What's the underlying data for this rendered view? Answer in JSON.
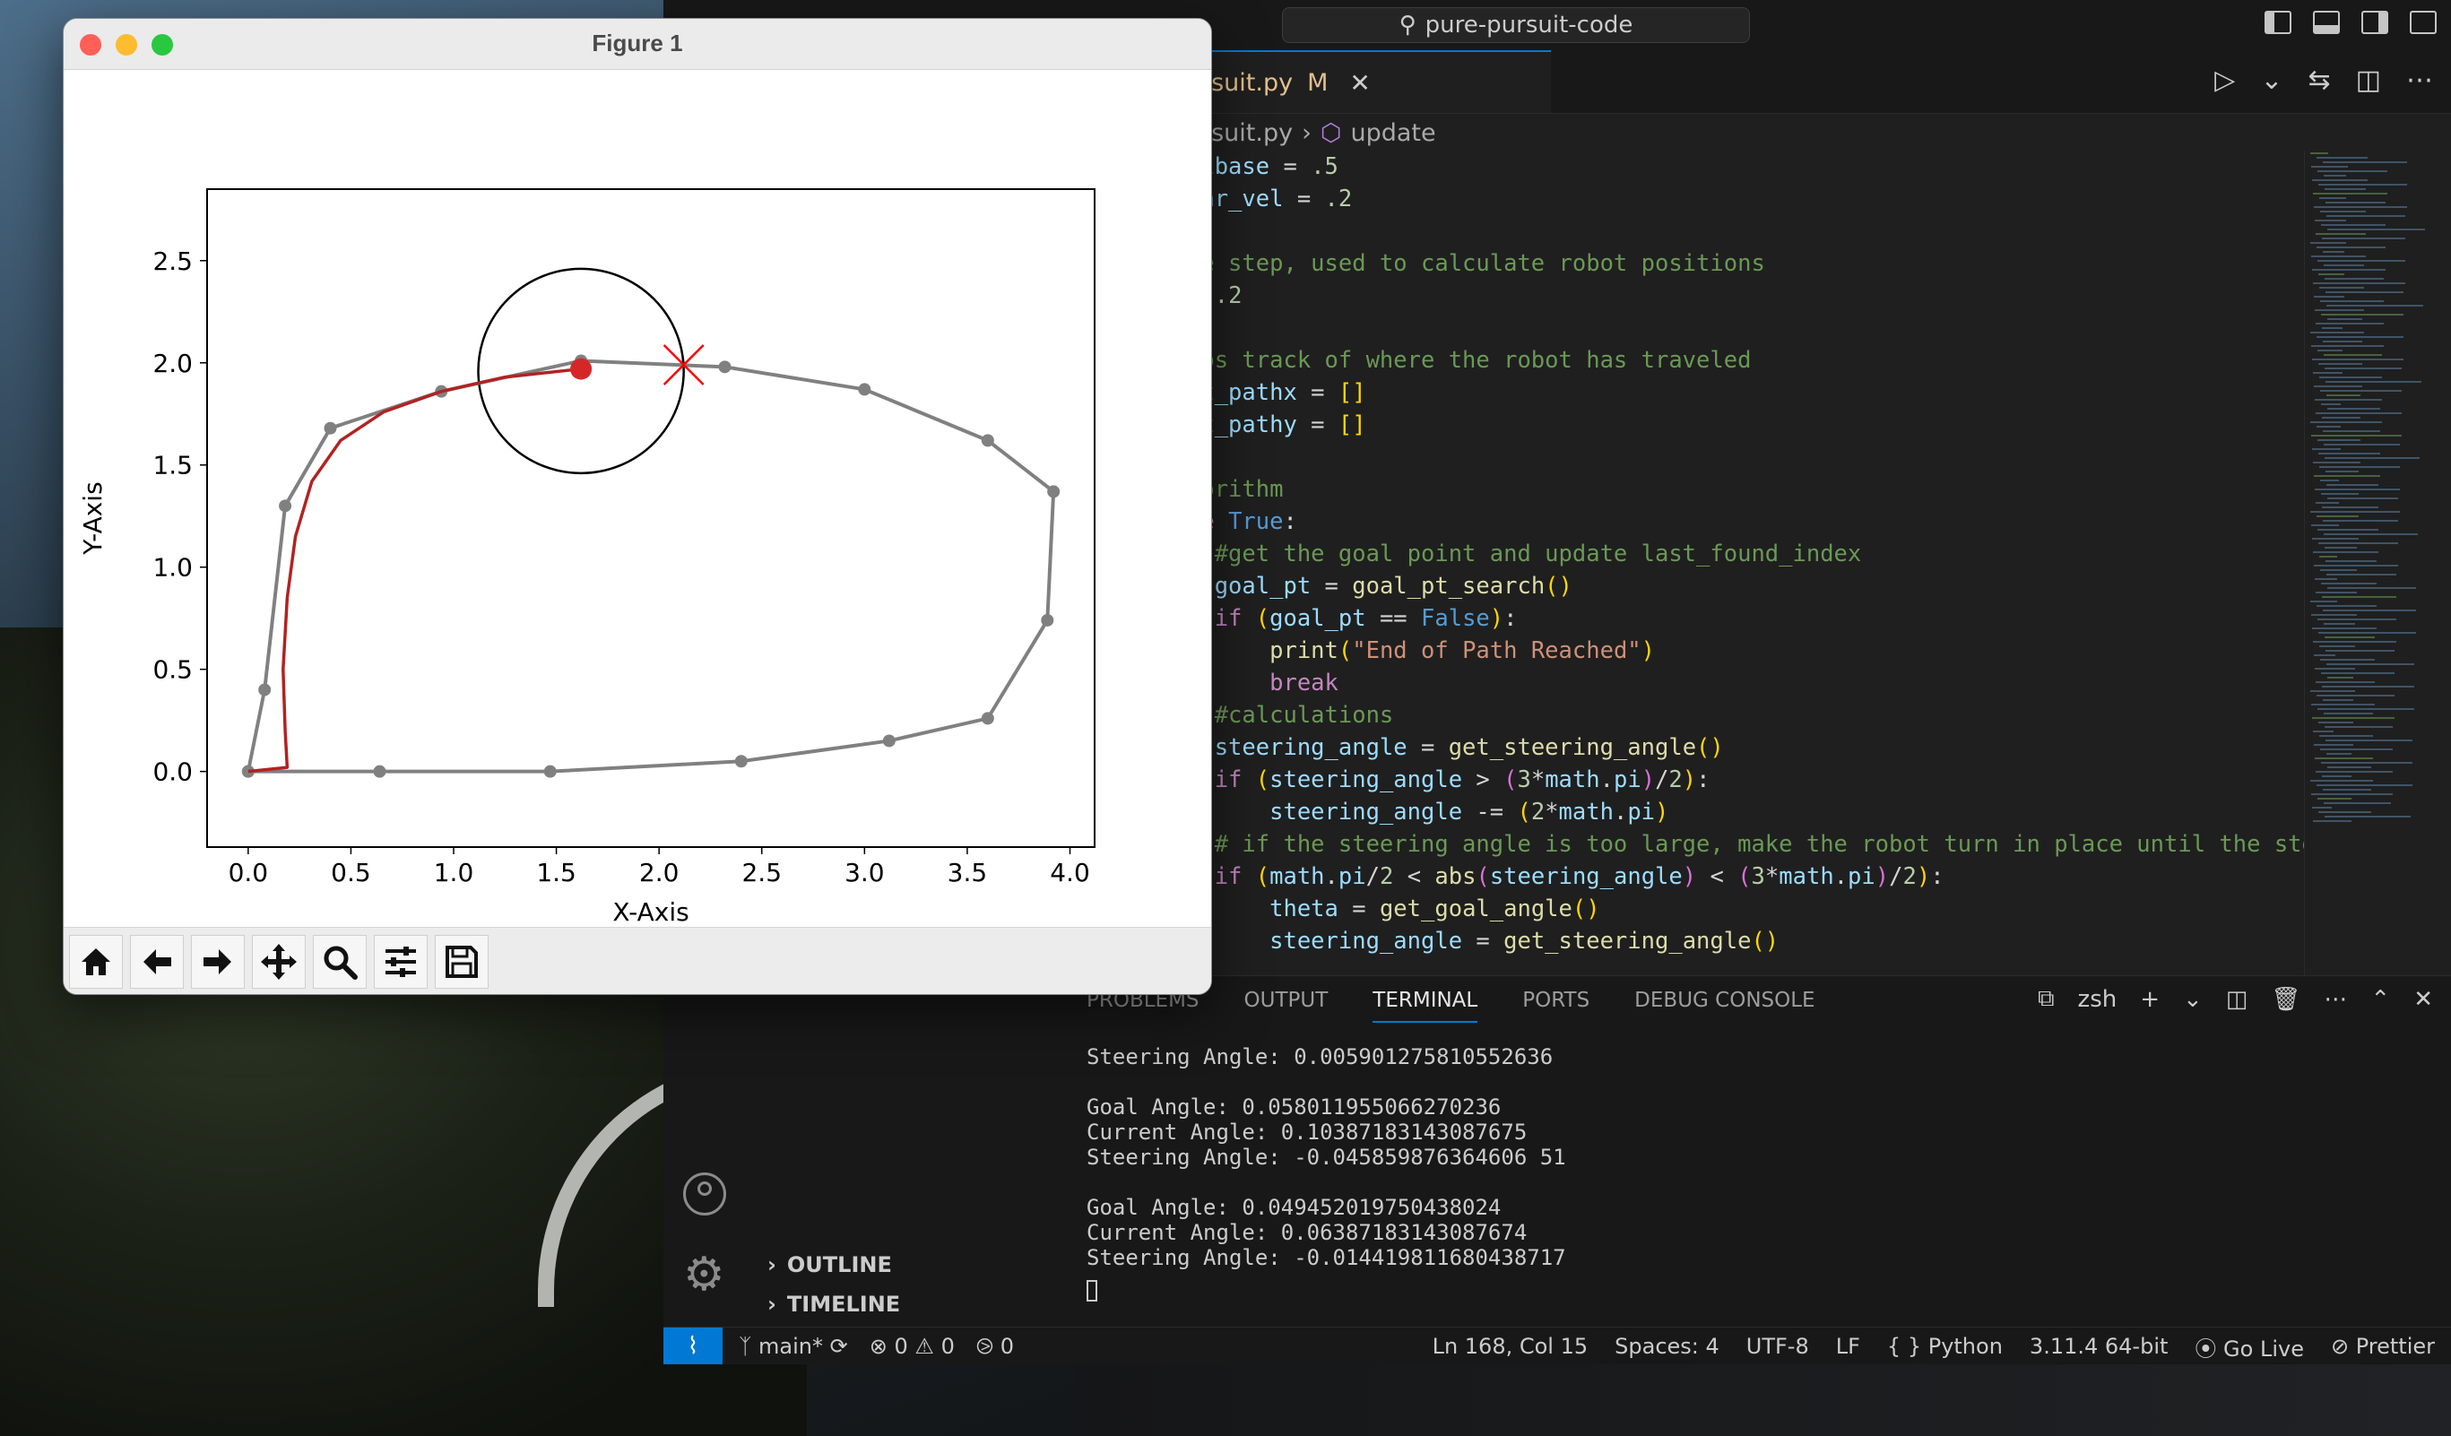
{
  "figure": {
    "title": "Figure 1",
    "toolbar": [
      "home-icon",
      "back-arrow-icon",
      "forward-arrow-icon",
      "pan-move-icon",
      "zoom-magnifier-icon",
      "configure-subplots-icon",
      "save-disk-icon"
    ]
  },
  "chart_data": {
    "type": "scatter",
    "xlabel": "X-Axis",
    "ylabel": "Y-Axis",
    "xlim": [
      -0.2,
      4.12
    ],
    "ylim": [
      -0.37,
      2.85
    ],
    "xticks": [
      "0.0",
      "0.5",
      "1.0",
      "1.5",
      "2.0",
      "2.5",
      "3.0",
      "3.5",
      "4.0"
    ],
    "yticks": [
      "0.0",
      "0.5",
      "1.0",
      "1.5",
      "2.0",
      "2.5"
    ],
    "grid": false,
    "series": [
      {
        "role": "path",
        "color": "#808080",
        "x": [
          0.0,
          0.64,
          1.47,
          2.4,
          3.12,
          3.6,
          3.89,
          3.92,
          3.6,
          3.0,
          2.32,
          1.62,
          0.94,
          0.4,
          0.18,
          0.08,
          0.0
        ],
        "y": [
          0.0,
          0.0,
          0.0,
          0.05,
          0.15,
          0.26,
          0.74,
          1.37,
          1.62,
          1.87,
          1.98,
          2.01,
          1.86,
          1.68,
          1.3,
          0.4,
          0.0
        ]
      },
      {
        "role": "robot-trajectory",
        "color": "#b22222",
        "x": [
          0.0,
          0.19,
          0.18,
          0.17,
          0.19,
          0.23,
          0.31,
          0.45,
          0.66,
          0.94,
          1.25,
          1.62
        ],
        "y": [
          0.0,
          0.02,
          0.2,
          0.5,
          0.85,
          1.15,
          1.42,
          1.62,
          1.76,
          1.86,
          1.93,
          1.97
        ]
      }
    ],
    "robot_position": {
      "x": 1.62,
      "y": 1.97,
      "color": "#d62728"
    },
    "lookahead_circle": {
      "cx": 1.62,
      "cy": 1.96,
      "r": 0.5,
      "color": "#000000"
    },
    "goal_point": {
      "x": 2.12,
      "y": 1.99,
      "color": "#ff0000",
      "marker": "x"
    }
  },
  "vscode": {
    "search": "pure-pursuit-code",
    "tab": {
      "name": "rsuit.py",
      "modified": "M",
      "close": "✕"
    },
    "breadcrumb": {
      "file": "rsuit.py",
      "symbol": "update"
    },
    "code": [
      [
        [
          "tk-var",
          "elbase"
        ],
        [
          "tk-op",
          " = "
        ],
        [
          "tk-num",
          ".5"
        ]
      ],
      [
        [
          "tk-var",
          "ear_vel"
        ],
        [
          "tk-op",
          " = "
        ],
        [
          "tk-num",
          ".2"
        ]
      ],
      [],
      [
        [
          "tk-com",
          "ne step, used to calculate robot positions"
        ]
      ],
      [
        [
          "tk-op",
          "= "
        ],
        [
          "tk-num",
          ".2"
        ]
      ],
      [],
      [
        [
          "tk-com",
          "eps track of where the robot has traveled"
        ]
      ],
      [
        [
          "tk-var",
          "ot_pathx"
        ],
        [
          "tk-op",
          " = "
        ],
        [
          "tk-br",
          "[]"
        ]
      ],
      [
        [
          "tk-var",
          "ot_pathy"
        ],
        [
          "tk-op",
          " = "
        ],
        [
          "tk-br",
          "[]"
        ]
      ],
      [],
      [
        [
          "tk-com",
          "gorithm"
        ]
      ],
      [
        [
          "tk-ctl",
          "le "
        ],
        [
          "tk-kw",
          "True"
        ],
        [
          "tk-op",
          ":"
        ]
      ],
      [
        [
          "tk-com",
          "  #get the goal point and update last_found_index"
        ]
      ],
      [
        [
          "tk-var",
          "  goal_pt"
        ],
        [
          "tk-op",
          " = "
        ],
        [
          "tk-fn",
          "goal_pt_search"
        ],
        [
          "tk-br",
          "()"
        ]
      ],
      [
        [
          "tk-ctl",
          "  if "
        ],
        [
          "tk-br",
          "("
        ],
        [
          "tk-var",
          "goal_pt"
        ],
        [
          "tk-op",
          " == "
        ],
        [
          "tk-kw",
          "False"
        ],
        [
          "tk-br",
          ")"
        ],
        [
          "tk-op",
          ":"
        ]
      ],
      [
        [
          "tk-fn",
          "      print"
        ],
        [
          "tk-br",
          "("
        ],
        [
          "tk-str",
          "\"End of Path Reached\""
        ],
        [
          "tk-br",
          ")"
        ]
      ],
      [
        [
          "tk-ctl",
          "      break"
        ]
      ],
      [
        [
          "tk-com",
          "  #calculations"
        ]
      ],
      [
        [
          "tk-var",
          "  steering_angle"
        ],
        [
          "tk-op",
          " = "
        ],
        [
          "tk-fn",
          "get_steering_angle"
        ],
        [
          "tk-br",
          "()"
        ]
      ],
      [
        [
          "tk-ctl",
          "  if "
        ],
        [
          "tk-br",
          "("
        ],
        [
          "tk-var",
          "steering_angle"
        ],
        [
          "tk-op",
          " > "
        ],
        [
          "tk-br2",
          "("
        ],
        [
          "tk-num",
          "3"
        ],
        [
          "tk-op",
          "*"
        ],
        [
          "tk-var",
          "math"
        ],
        [
          "tk-op",
          "."
        ],
        [
          "tk-var",
          "pi"
        ],
        [
          "tk-br2",
          ")"
        ],
        [
          "tk-op",
          "/"
        ],
        [
          "tk-num",
          "2"
        ],
        [
          "tk-br",
          ")"
        ],
        [
          "tk-op",
          ":"
        ]
      ],
      [
        [
          "tk-var",
          "      steering_angle"
        ],
        [
          "tk-op",
          " -= "
        ],
        [
          "tk-br",
          "("
        ],
        [
          "tk-num",
          "2"
        ],
        [
          "tk-op",
          "*"
        ],
        [
          "tk-var",
          "math"
        ],
        [
          "tk-op",
          "."
        ],
        [
          "tk-var",
          "pi"
        ],
        [
          "tk-br",
          ")"
        ]
      ],
      [
        [
          "tk-com",
          "  # if the steering angle is too large, make the robot turn in place until the steerin"
        ]
      ],
      [
        [
          "tk-ctl",
          "  if "
        ],
        [
          "tk-br",
          "("
        ],
        [
          "tk-var",
          "math"
        ],
        [
          "tk-op",
          "."
        ],
        [
          "tk-var",
          "pi"
        ],
        [
          "tk-op",
          "/"
        ],
        [
          "tk-num",
          "2"
        ],
        [
          "tk-op",
          " < "
        ],
        [
          "tk-fn",
          "abs"
        ],
        [
          "tk-br2",
          "("
        ],
        [
          "tk-var",
          "steering_angle"
        ],
        [
          "tk-br2",
          ")"
        ],
        [
          "tk-op",
          " < "
        ],
        [
          "tk-br2",
          "("
        ],
        [
          "tk-num",
          "3"
        ],
        [
          "tk-op",
          "*"
        ],
        [
          "tk-var",
          "math"
        ],
        [
          "tk-op",
          "."
        ],
        [
          "tk-var",
          "pi"
        ],
        [
          "tk-br2",
          ")"
        ],
        [
          "tk-op",
          "/"
        ],
        [
          "tk-num",
          "2"
        ],
        [
          "tk-br",
          ")"
        ],
        [
          "tk-op",
          ":"
        ]
      ],
      [
        [
          "tk-var",
          "      theta"
        ],
        [
          "tk-op",
          " = "
        ],
        [
          "tk-fn",
          "get_goal_angle"
        ],
        [
          "tk-br",
          "()"
        ]
      ],
      [
        [
          "tk-var",
          "      steering_angle"
        ],
        [
          "tk-op",
          " = "
        ],
        [
          "tk-fn",
          "get_steering_angle"
        ],
        [
          "tk-br",
          "()"
        ]
      ]
    ],
    "panel": {
      "tabs": [
        "PROBLEMS",
        "OUTPUT",
        "TERMINAL",
        "PORTS",
        "DEBUG CONSOLE"
      ],
      "active": 2,
      "shell": "zsh",
      "terminal": [
        "Steering Angle: 0.005901275810552636",
        "",
        "Goal Angle: 0.058011955066270236",
        "Current Angle: 0.10387183143087675",
        "Steering Angle: -0.045859876364606 51",
        "",
        "Goal Angle: 0.049452019750438024",
        "Current Angle: 0.06387183143087674",
        "Steering Angle: -0.014419811680438717"
      ]
    },
    "sidepanel": {
      "outline": "OUTLINE",
      "timeline": "TIMELINE"
    },
    "status": {
      "branch": "main*",
      "errors": "0",
      "warnings": "0",
      "ports": "0",
      "position": "Ln 168, Col 15",
      "spaces": "Spaces: 4",
      "encoding": "UTF-8",
      "eol": "LF",
      "language": "Python",
      "interpreter": "3.11.4 64-bit",
      "golive": "Go Live",
      "prettier": "Prettier"
    }
  }
}
